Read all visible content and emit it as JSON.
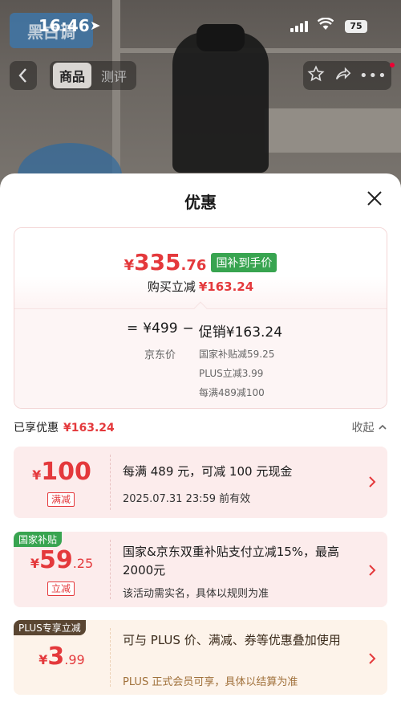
{
  "status_bar": {
    "time": "16:46",
    "battery": "75"
  },
  "header": {
    "brand": "黑白调",
    "tabs": [
      {
        "label": "商品"
      },
      {
        "label": "测评"
      }
    ]
  },
  "sheet": {
    "title": "优惠",
    "summary": {
      "currency": "¥",
      "price_int": "335",
      "price_dec": ".76",
      "price_tag": "国补到手价",
      "buy_label": "购买立减",
      "buy_amount": "¥163.24",
      "formula": {
        "eq": "=",
        "base": "¥499",
        "minus": "−",
        "promo": "促销¥163.24"
      },
      "base_label": "京东价",
      "details": [
        "国家补贴减59.25",
        "PLUS立减3.99",
        "每满489减100"
      ]
    },
    "enjoyed": {
      "label": "已享优惠",
      "amount": "¥163.24",
      "collapse": "收起"
    },
    "coupons": [
      {
        "ribbon": "",
        "currency": "¥",
        "amount_int": "100",
        "amount_dec": "",
        "badge": "满减",
        "text": "每满 489 元，可减 100 元现金",
        "sub": "2025.07.31 23:59 前有效",
        "color": "#e4393c"
      },
      {
        "ribbon": "国家补贴",
        "currency": "¥",
        "amount_int": "59",
        "amount_dec": ".25",
        "badge": "立减",
        "text": "国家&京东双重补贴支付立减15%，最高2000元",
        "sub": "该活动需实名，具体以规则为准",
        "color": "#38a450"
      },
      {
        "ribbon": "PLUS专享立减",
        "currency": "¥",
        "amount_int": "3",
        "amount_dec": ".99",
        "badge": "",
        "text": "可与 PLUS 价、满减、券等优惠叠加使用",
        "sub": "PLUS 正式会员可享，具体以结算为准",
        "color": "#5a4632"
      }
    ]
  },
  "colors": {
    "accent_red": "#e4393c",
    "gov_green": "#38a450",
    "plus_brown": "#5a4632"
  }
}
